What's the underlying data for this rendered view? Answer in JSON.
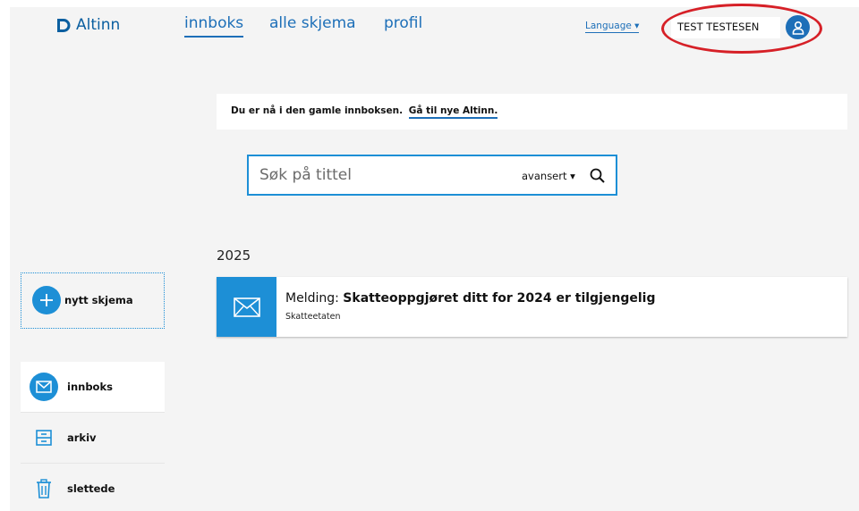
{
  "header": {
    "logo_text": "Altinn",
    "nav": {
      "innboks": "innboks",
      "alle_skjema": "alle skjema",
      "profil": "profil"
    },
    "language_label": "Language ▾",
    "user_name": "TEST TESTESEN"
  },
  "notice": {
    "text": "Du er nå i den gamle innboksen.",
    "link_text": "Gå til nye Altinn."
  },
  "search": {
    "placeholder": "Søk på tittel",
    "advanced_label": "avansert ▾"
  },
  "inbox": {
    "year": "2025",
    "messages": [
      {
        "type_label": "Melding:",
        "title": "Skatteoppgjøret ditt for 2024 er tilgjengelig",
        "sender": "Skatteetaten"
      }
    ]
  },
  "sidebar": {
    "new_form_label": "nytt skjema",
    "items": [
      {
        "label": "innboks",
        "icon": "envelope-icon"
      },
      {
        "label": "arkiv",
        "icon": "archive-icon"
      },
      {
        "label": "slettede",
        "icon": "trash-icon"
      }
    ]
  },
  "colors": {
    "brand_blue": "#1d8fd6",
    "link_blue": "#1d6fb8",
    "highlight_red": "#d62027",
    "background": "#f4f4f4"
  }
}
